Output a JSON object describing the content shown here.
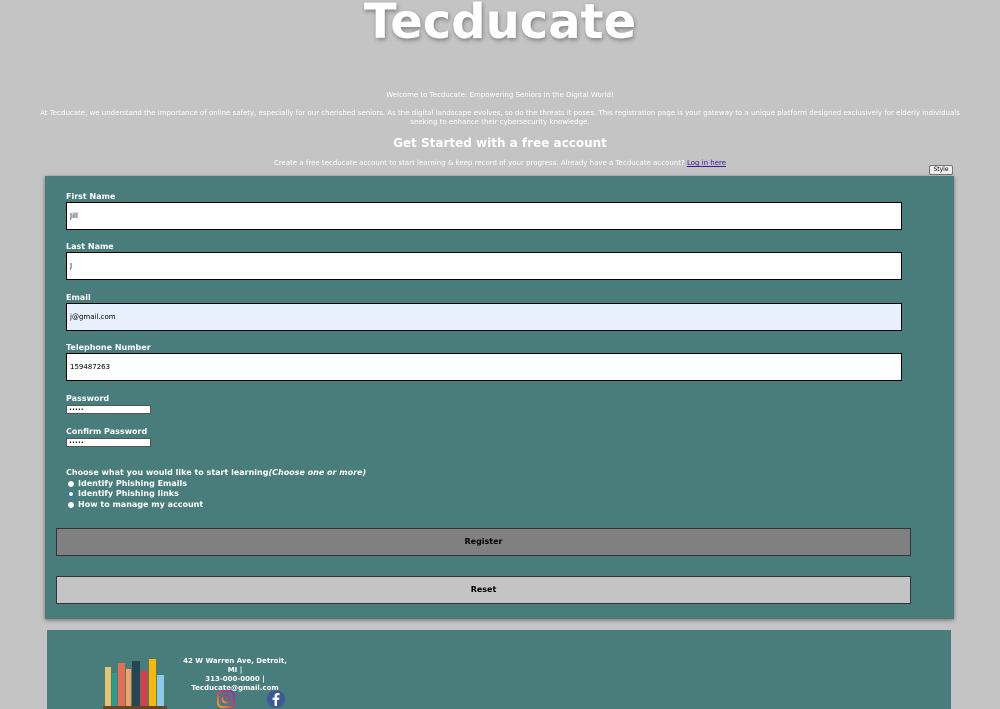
{
  "header": {
    "title": "Tecducate",
    "welcome": "Welcome to Tecducate: Empowering Seniors in the Digital World!",
    "intro": "At Tecducate, we understand the importance of online safety, especially for our cherished seniors. As the digital landscape evolves, so do the threats it poses. This registration page is your gateway to a unique platform designed exclusively for elderly individuals seeking to enhance their cybersecurity knowledge.",
    "get_started": "Get Started with a free account",
    "create_text": "Create a free tecducate account to start learning & keep record of your progress. Already have a Tecducate account?",
    "login_link": "Log in here",
    "style_button": "Style"
  },
  "form": {
    "first_name": {
      "label": "First Name",
      "value": "Jill"
    },
    "last_name": {
      "label": "Last Name",
      "value": "J"
    },
    "email": {
      "label": "Email",
      "value": "j@gmail.com"
    },
    "telephone": {
      "label": "Telephone Number",
      "value": "159487263"
    },
    "password": {
      "label": "Password",
      "value": "•••••"
    },
    "confirm_password": {
      "label": "Confirm Password",
      "value": "•••••"
    },
    "choose_label": "Choose what you would like to start learning",
    "choose_hint": "(Choose one or more)",
    "options": [
      {
        "label": "Identify Phishing Emails",
        "checked": false
      },
      {
        "label": "Identify Phishing links",
        "checked": true
      },
      {
        "label": "How to manage my account",
        "checked": false
      }
    ],
    "register_label": "Register",
    "reset_label": "Reset"
  },
  "footer": {
    "address": "42 W Warren Ave, Detroit, MI |",
    "phone": "313-000-0000 |",
    "email": "Tecducate@gmail.com",
    "icons": [
      "books-logo",
      "instagram-icon",
      "facebook-icon"
    ]
  },
  "colors": {
    "background": "#c4c4c4",
    "panel": "#497d7c",
    "register_button": "#808080",
    "reset_button": "#c4c4c4",
    "link": "#3a1a9e"
  }
}
